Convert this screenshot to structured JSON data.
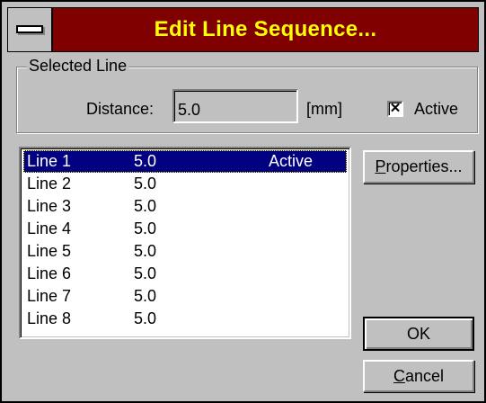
{
  "window": {
    "title": "Edit Line Sequence..."
  },
  "selected_line": {
    "group_label": "Selected Line",
    "distance_label": "Distance:",
    "distance_value": "5.0",
    "unit": "[mm]",
    "active_checked": true,
    "active_label": "Active",
    "check_mark": "✕"
  },
  "list": {
    "rows": [
      {
        "name": "Line 1",
        "distance": "5.0",
        "state": "Active",
        "selected": true
      },
      {
        "name": "Line 2",
        "distance": "5.0",
        "state": ""
      },
      {
        "name": "Line 3",
        "distance": "5.0",
        "state": ""
      },
      {
        "name": "Line 4",
        "distance": "5.0",
        "state": ""
      },
      {
        "name": "Line 5",
        "distance": "5.0",
        "state": ""
      },
      {
        "name": "Line 6",
        "distance": "5.0",
        "state": ""
      },
      {
        "name": "Line 7",
        "distance": "5.0",
        "state": ""
      },
      {
        "name": "Line 8",
        "distance": "5.0",
        "state": ""
      }
    ]
  },
  "buttons": {
    "properties_mnemonic": "P",
    "properties_rest": "roperties...",
    "ok": "OK",
    "cancel_mnemonic": "C",
    "cancel_rest": "ancel"
  },
  "colors": {
    "title_bar": "#800000",
    "title_text": "#ffff00",
    "face": "#c0c0c0",
    "selection": "#000080"
  },
  "icons": {
    "system_menu": "system-menu-icon"
  }
}
